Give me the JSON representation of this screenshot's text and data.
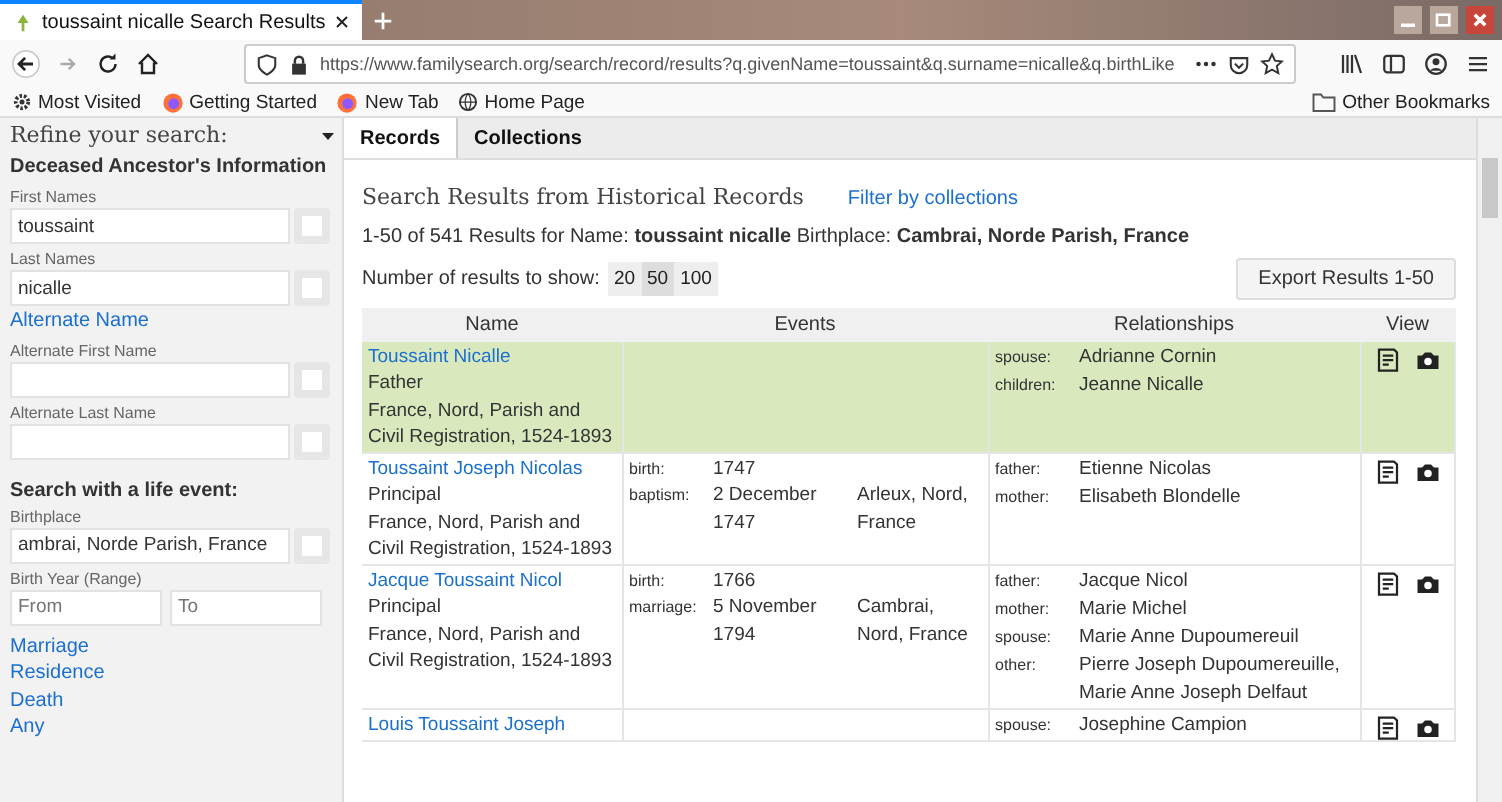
{
  "browser": {
    "tabs": [
      {
        "title": "toussaint nicalle Search Results",
        "selected": true
      }
    ],
    "url": "https://www.familysearch.org/search/record/results?q.givenName=toussaint&q.surname=nicalle&q.birthLike",
    "bookmarks": [
      {
        "label": "Most Visited",
        "kind": "gear"
      },
      {
        "label": "Getting Started",
        "kind": "firefox"
      },
      {
        "label": "New Tab",
        "kind": "firefox"
      },
      {
        "label": "Home Page",
        "kind": "globe"
      }
    ],
    "other_bookmarks": "Other Bookmarks"
  },
  "sidebar": {
    "title": "Refine your search:",
    "section": "Deceased Ancestor's Information",
    "fields": [
      {
        "label": "First Names",
        "value": "toussaint",
        "checked": false
      },
      {
        "label": "Last Names",
        "value": "nicalle",
        "checked": false
      }
    ],
    "alternate_link": "Alternate Name",
    "alternate_fields": [
      {
        "label": "Alternate First Name",
        "checked": false
      },
      {
        "label": "Alternate Last Name",
        "checked": false
      }
    ],
    "life_event_title": "Search with a life event:",
    "birthplace": {
      "label": "Birthplace",
      "value": "ambrai, Norde Parish, France",
      "checked": false
    },
    "birth_year": {
      "label": "Birth Year (Range)",
      "from_placeholder": "From",
      "to_placeholder": "To"
    },
    "event_links": [
      "Marriage",
      "Residence",
      "Death",
      "Any"
    ]
  },
  "main": {
    "tabs": [
      {
        "label": "Records",
        "selected": true
      },
      {
        "label": "Collections",
        "selected": false
      }
    ],
    "heading": "Search Results from Historical Records",
    "filter_link": "Filter by collections",
    "summary": "1-50 of 541 Results for Name: **toussaint nicalle** Birthplace: **Cambrai, Norde Parish, France**",
    "page_size_label": "Number of results to show:",
    "page_sizes": [
      {
        "label": "20",
        "selected": false
      },
      {
        "label": "50",
        "selected": true
      },
      {
        "label": "100",
        "selected": false
      }
    ],
    "export_button": "Export Results 1-50",
    "table": {
      "columns": [
        "Name",
        "Events",
        "Relationships",
        "View"
      ],
      "rows": [
        {
          "highlighted": true,
          "name": "Toussaint Nicalle",
          "role": "Father",
          "collection": "France, Nord, Parish and Civil Registration, 1524-1893",
          "events": [],
          "relationships": [
            {
              "label": "spouse:",
              "name": "Adrianne Cornin"
            },
            {
              "label": "children:",
              "name": "Jeanne Nicalle"
            }
          ]
        },
        {
          "highlighted": false,
          "name": "Toussaint Joseph Nicolas",
          "role": "Principal",
          "collection": "France, Nord, Parish and Civil Registration, 1524-1893",
          "events": [
            {
              "label": "birth:",
              "date": "1747"
            },
            {
              "label": "baptism:",
              "date": "2 December 1747",
              "place": "Arleux, Nord, France"
            }
          ],
          "relationships": [
            {
              "label": "father:",
              "name": "Etienne Nicolas"
            },
            {
              "label": "mother:",
              "name": "Elisabeth Blondelle"
            }
          ]
        },
        {
          "highlighted": false,
          "name": "Jacque Toussaint Nicol",
          "role": "Principal",
          "collection": "France, Nord, Parish and Civil Registration, 1524-1893",
          "events": [
            {
              "label": "birth:",
              "date": "1766"
            },
            {
              "label": "marriage:",
              "date": "5 November 1794",
              "place": "Cambrai, Nord, France"
            }
          ],
          "relationships": [
            {
              "label": "father:",
              "name": "Jacque Nicol"
            },
            {
              "label": "mother:",
              "name": "Marie Michel"
            },
            {
              "label": "spouse:",
              "name": "Marie Anne Dupoumereuil"
            },
            {
              "label": "other:",
              "name": "Pierre Joseph Dupoumereuille, Marie Anne Joseph Delfaut"
            }
          ]
        },
        {
          "highlighted": false,
          "name": "Louis Toussaint Joseph",
          "relationships": [
            {
              "label": "spouse:",
              "name": "Josephine Campion"
            }
          ],
          "events": []
        }
      ]
    }
  }
}
